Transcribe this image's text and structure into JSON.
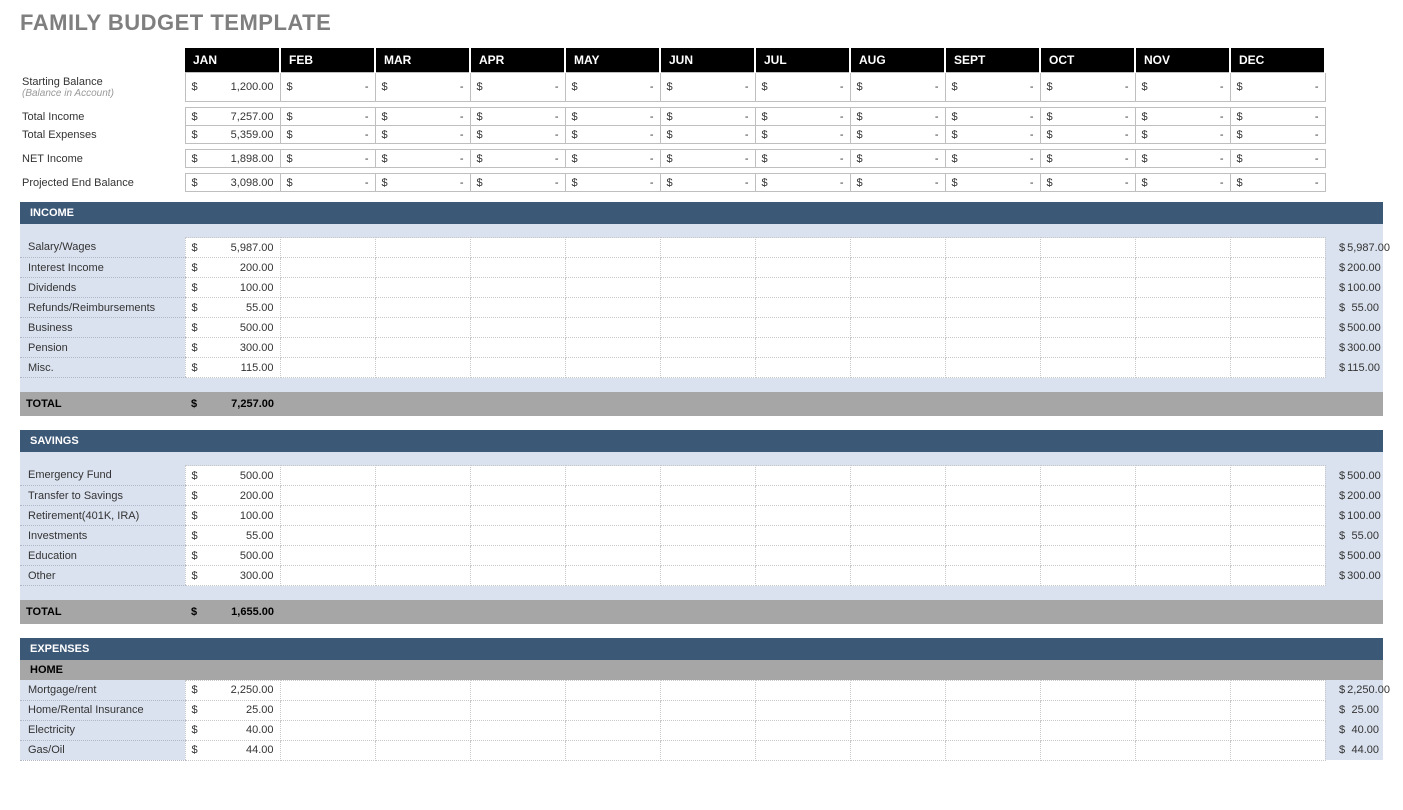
{
  "title": "FAMILY BUDGET TEMPLATE",
  "months": [
    "JAN",
    "FEB",
    "MAR",
    "APR",
    "MAY",
    "JUN",
    "JUL",
    "AUG",
    "SEPT",
    "OCT",
    "NOV",
    "DEC"
  ],
  "summary": [
    {
      "label": "Starting Balance",
      "sub": "(Balance in Account)",
      "jan": "1,200.00"
    },
    {
      "label": "Total Income",
      "jan": "7,257.00"
    },
    {
      "label": "Total Expenses",
      "jan": "5,359.00"
    },
    {
      "label": "NET Income",
      "jan": "1,898.00"
    },
    {
      "label": "Projected End Balance",
      "jan": "3,098.00"
    }
  ],
  "sections": [
    {
      "title": "INCOME",
      "rows": [
        {
          "label": "Salary/Wages",
          "jan": "5,987.00",
          "total": "5,987.00"
        },
        {
          "label": "Interest Income",
          "jan": "200.00",
          "total": "200.00"
        },
        {
          "label": "Dividends",
          "jan": "100.00",
          "total": "100.00"
        },
        {
          "label": "Refunds/Reimbursements",
          "jan": "55.00",
          "total": "55.00"
        },
        {
          "label": "Business",
          "jan": "500.00",
          "total": "500.00"
        },
        {
          "label": "Pension",
          "jan": "300.00",
          "total": "300.00"
        },
        {
          "label": "Misc.",
          "jan": "115.00",
          "total": "115.00"
        }
      ],
      "total_label": "TOTAL",
      "total_jan": "7,257.00"
    },
    {
      "title": "SAVINGS",
      "rows": [
        {
          "label": "Emergency Fund",
          "jan": "500.00",
          "total": "500.00"
        },
        {
          "label": "Transfer to Savings",
          "jan": "200.00",
          "total": "200.00"
        },
        {
          "label": "Retirement(401K, IRA)",
          "jan": "100.00",
          "total": "100.00"
        },
        {
          "label": "Investments",
          "jan": "55.00",
          "total": "55.00"
        },
        {
          "label": "Education",
          "jan": "500.00",
          "total": "500.00"
        },
        {
          "label": "Other",
          "jan": "300.00",
          "total": "300.00"
        }
      ],
      "total_label": "TOTAL",
      "total_jan": "1,655.00"
    },
    {
      "title": "EXPENSES",
      "subtitle": "HOME",
      "rows": [
        {
          "label": "Mortgage/rent",
          "jan": "2,250.00",
          "total": "2,250.00"
        },
        {
          "label": "Home/Rental Insurance",
          "jan": "25.00",
          "total": "25.00"
        },
        {
          "label": "Electricity",
          "jan": "40.00",
          "total": "40.00"
        },
        {
          "label": "Gas/Oil",
          "jan": "44.00",
          "total": "44.00"
        }
      ]
    }
  ],
  "currency": "$",
  "dash": "-"
}
